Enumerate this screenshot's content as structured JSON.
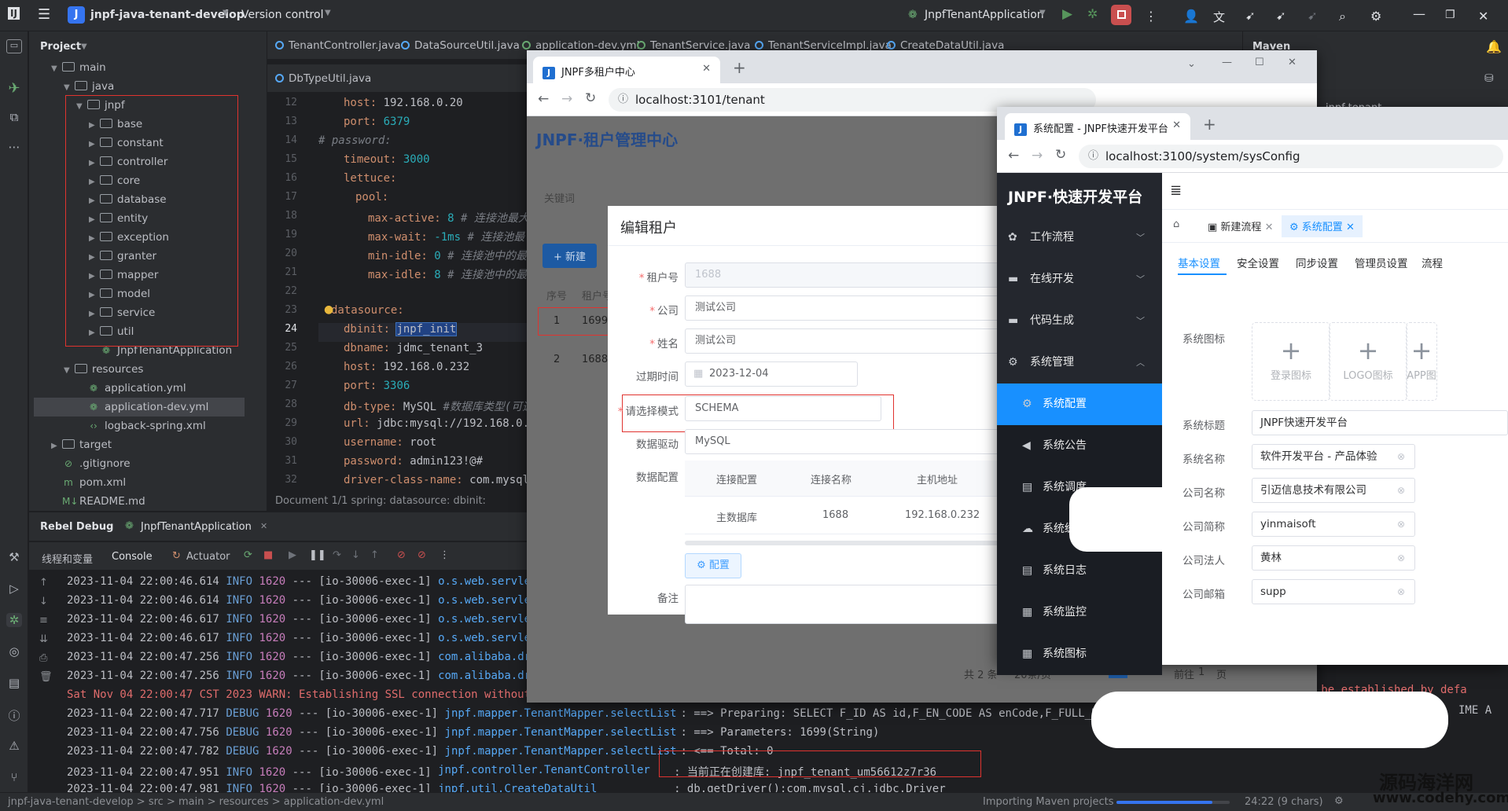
{
  "ide": {
    "project_name": "jnpf-java-tenant-develop",
    "version_control": "Version control",
    "run_config": "JnpfTenantApplication",
    "project_label": "Project",
    "maven_label": "Maven",
    "maven_item": "jnpf-tenant",
    "tree": [
      "main",
      "java",
      "jnpf",
      "base",
      "constant",
      "controller",
      "core",
      "database",
      "entity",
      "exception",
      "granter",
      "mapper",
      "model",
      "service",
      "util",
      "JnpfTenantApplication",
      "resources",
      "application.yml",
      "application-dev.yml",
      "logback-spring.xml",
      "target",
      ".gitignore",
      "pom.xml",
      "README.md"
    ],
    "editor_tabs": [
      "TenantController.java",
      "DataSourceUtil.java",
      "application-dev.yml",
      "TenantService.java",
      "TenantServiceImpl.java",
      "CreateDataUtil.java"
    ],
    "editor_tab2": "DbTypeUtil.java",
    "line_numbers": [
      "12",
      "13",
      "14",
      "15",
      "16",
      "17",
      "18",
      "19",
      "20",
      "21",
      "22",
      "23",
      "24",
      "25",
      "26",
      "27",
      "28",
      "29",
      "30",
      "31",
      "32"
    ],
    "code": {
      "l12k": "host:",
      "l12v": " 192.168.0.20",
      "l13k": "port:",
      "l13v": " 6379",
      "l14": "#  password:",
      "l15k": "timeout:",
      "l15v": " 3000",
      "l16k": "lettuce:",
      "l17k": "pool:",
      "l18k": "max-active:",
      "l18v": " 8",
      "l18c": " # 连接池最大",
      "l19k": "max-wait:",
      "l19v": " -1ms",
      "l19c": "  # 连接池最",
      "l20k": "min-idle:",
      "l20v": " 0",
      "l20c": " # 连接池中的最",
      "l21k": "max-idle:",
      "l21v": " 8",
      "l21c": " # 连接池中的最",
      "l23k": "datasource:",
      "l24k": "dbinit:",
      "l24v": "jnpf_init",
      "l25k": "dbname:",
      "l25v": " jdmc_tenant_3",
      "l26k": "host:",
      "l26v": " 192.168.0.232",
      "l27k": "port:",
      "l27v": " 3306",
      "l28k": "db-type:",
      "l28v": " MySQL ",
      "l28c": "#数据库类型(可选",
      "l29k": "url:",
      "l29v": " jdbc:mysql://192.168.0.2",
      "l30k": "username:",
      "l30v": " root",
      "l31k": "password:",
      "l31v": " admin123!@#",
      "l32k": "driver-class-name:",
      "l32v": " com.mysql."
    },
    "crumb": "Document 1/1   spring:   datasource:   dbinit:",
    "debug_title": "Rebel Debug",
    "debug_tab": "JnpfTenantApplication",
    "debug_tools": [
      "线程和变量",
      "Console",
      "Actuator"
    ],
    "logs": [
      {
        "t": "2023-11-04 22:00:46.614",
        "lv": "INFO",
        "pid": "1620",
        "th": "--- [io-30006-exec-1]",
        "c": "o.s.web.servlet."
      },
      {
        "t": "2023-11-04 22:00:46.614",
        "lv": "INFO",
        "pid": "1620",
        "th": "--- [io-30006-exec-1]",
        "c": "o.s.web.servlet."
      },
      {
        "t": "2023-11-04 22:00:46.617",
        "lv": "INFO",
        "pid": "1620",
        "th": "--- [io-30006-exec-1]",
        "c": "o.s.web.servlet."
      },
      {
        "t": "2023-11-04 22:00:46.617",
        "lv": "INFO",
        "pid": "1620",
        "th": "--- [io-30006-exec-1]",
        "c": "o.s.web.servlet."
      },
      {
        "t": "2023-11-04 22:00:47.256",
        "lv": "INFO",
        "pid": "1620",
        "th": "--- [io-30006-exec-1]",
        "c": "com.alibaba.drui"
      },
      {
        "t": "2023-11-04 22:00:47.256",
        "lv": "INFO",
        "pid": "1620",
        "th": "--- [io-30006-exec-1]",
        "c": "com.alibaba.drui"
      }
    ],
    "warn_line": "Sat Nov 04 22:00:47 CST 2023 WARN: Establishing SSL connection without se",
    "logs2": [
      {
        "t": "2023-11-04 22:00:47.717",
        "lv": "DEBUG",
        "pid": "1620",
        "th": "--- [io-30006-exec-1]",
        "c": "jnpf.mapper.TenantMapper.selectList",
        "m": ": ==>  Preparing: SELECT F_ID AS id,F_EN_CODE AS enCode,F_FULL_NA"
      },
      {
        "t": "2023-11-04 22:00:47.756",
        "lv": "DEBUG",
        "pid": "1620",
        "th": "--- [io-30006-exec-1]",
        "c": "jnpf.mapper.TenantMapper.selectList",
        "m": ": ==> Parameters: 1699(String)"
      },
      {
        "t": "2023-11-04 22:00:47.782",
        "lv": "DEBUG",
        "pid": "1620",
        "th": "--- [io-30006-exec-1]",
        "c": "jnpf.mapper.TenantMapper.selectList",
        "m": ": <==      Total: 0"
      },
      {
        "t": "2023-11-04 22:00:47.951",
        "lv": "INFO",
        "pid": "1620",
        "th": "--- [io-30006-exec-1]",
        "c": "jnpf.controller.TenantController",
        "m": ": 当前正在创建库: jnpf_tenant_um56612z7r36"
      },
      {
        "t": "2023-11-04 22:00:47.981",
        "lv": "INFO",
        "pid": "1620",
        "th": "--- [io-30006-exec-1]",
        "c": "jnpf.util.CreateDataUtil",
        "m": ": db.getDriver():com.mysql.cj.jdbc.Driver"
      }
    ],
    "log_right_fragment1": "st be established by defa",
    "log_right_fragment2": "IME A",
    "status": {
      "crumb": "jnpf-java-tenant-develop  >  src  >  main  >  resources  >  application-dev.yml",
      "importing": "Importing Maven projects",
      "pos": "24:22 (9 chars)",
      "watermark1": "源码海洋网",
      "watermark2": "www.codehy.com"
    }
  },
  "browser1": {
    "tab_title": "JNPF多租户中心",
    "url": "localhost:3101/tenant",
    "brand": "JNPF·租户管理中心",
    "dialog_title": "编辑租户",
    "labels": {
      "tenant_no": "租户号",
      "company": "公司",
      "name": "姓名",
      "expire": "过期时间",
      "mode": "请选择模式",
      "driver": "数据驱动",
      "dataconf": "数据配置",
      "remark": "备注"
    },
    "values": {
      "tenant_no": "1688",
      "company": "测试公司",
      "name": "测试公司",
      "expire": "2023-12-04",
      "mode": "SCHEMA",
      "driver": "MySQL"
    },
    "table_headers": [
      "连接配置",
      "连接名称",
      "主机地址"
    ],
    "table_row": [
      "主数据库",
      "1688",
      "192.168.0.232"
    ],
    "config_button": "配置",
    "bg_keyword": "关键词",
    "bg_new": "+ 新建",
    "bg_cols": [
      "序号",
      "租户号"
    ],
    "bg_rows": [
      [
        "1",
        "1699"
      ],
      [
        "2",
        "1688"
      ]
    ],
    "pager": {
      "total": "共 2 条",
      "size": "20条/页",
      "page": "1",
      "goto": "前往",
      "goto_val": "1",
      "unit": "页"
    }
  },
  "browser2": {
    "tab_title": "系统配置 - JNPF快速开发平台",
    "url": "localhost:3100/system/sysConfig",
    "logo": "JNPF·快速开发平台",
    "menu": [
      {
        "label": "工作流程"
      },
      {
        "label": "在线开发"
      },
      {
        "label": "代码生成"
      },
      {
        "label": "系统管理"
      }
    ],
    "submenu": [
      {
        "label": "系统配置"
      },
      {
        "label": "系统公告"
      },
      {
        "label": "系统调度"
      },
      {
        "label": "系统缓存"
      },
      {
        "label": "系统日志"
      },
      {
        "label": "系统监控"
      },
      {
        "label": "系统图标"
      }
    ],
    "page_tabs": [
      "新建流程",
      "系统配置"
    ],
    "sub_tabs": [
      "基本设置",
      "安全设置",
      "同步设置",
      "管理员设置",
      "流程"
    ],
    "icon_label": "系统图标",
    "uploads": [
      "登录图标",
      "LOGO图标",
      "APP图"
    ],
    "fields": [
      {
        "label": "系统标题",
        "value": "JNPF快速开发平台"
      },
      {
        "label": "系统名称",
        "value": "软件开发平台 - 产品体验"
      },
      {
        "label": "公司名称",
        "value": "引迈信息技术有限公司"
      },
      {
        "label": "公司简称",
        "value": "yinmaisoft"
      },
      {
        "label": "公司法人",
        "value": "黄林"
      },
      {
        "label": "公司邮箱",
        "value": "supp"
      }
    ]
  }
}
